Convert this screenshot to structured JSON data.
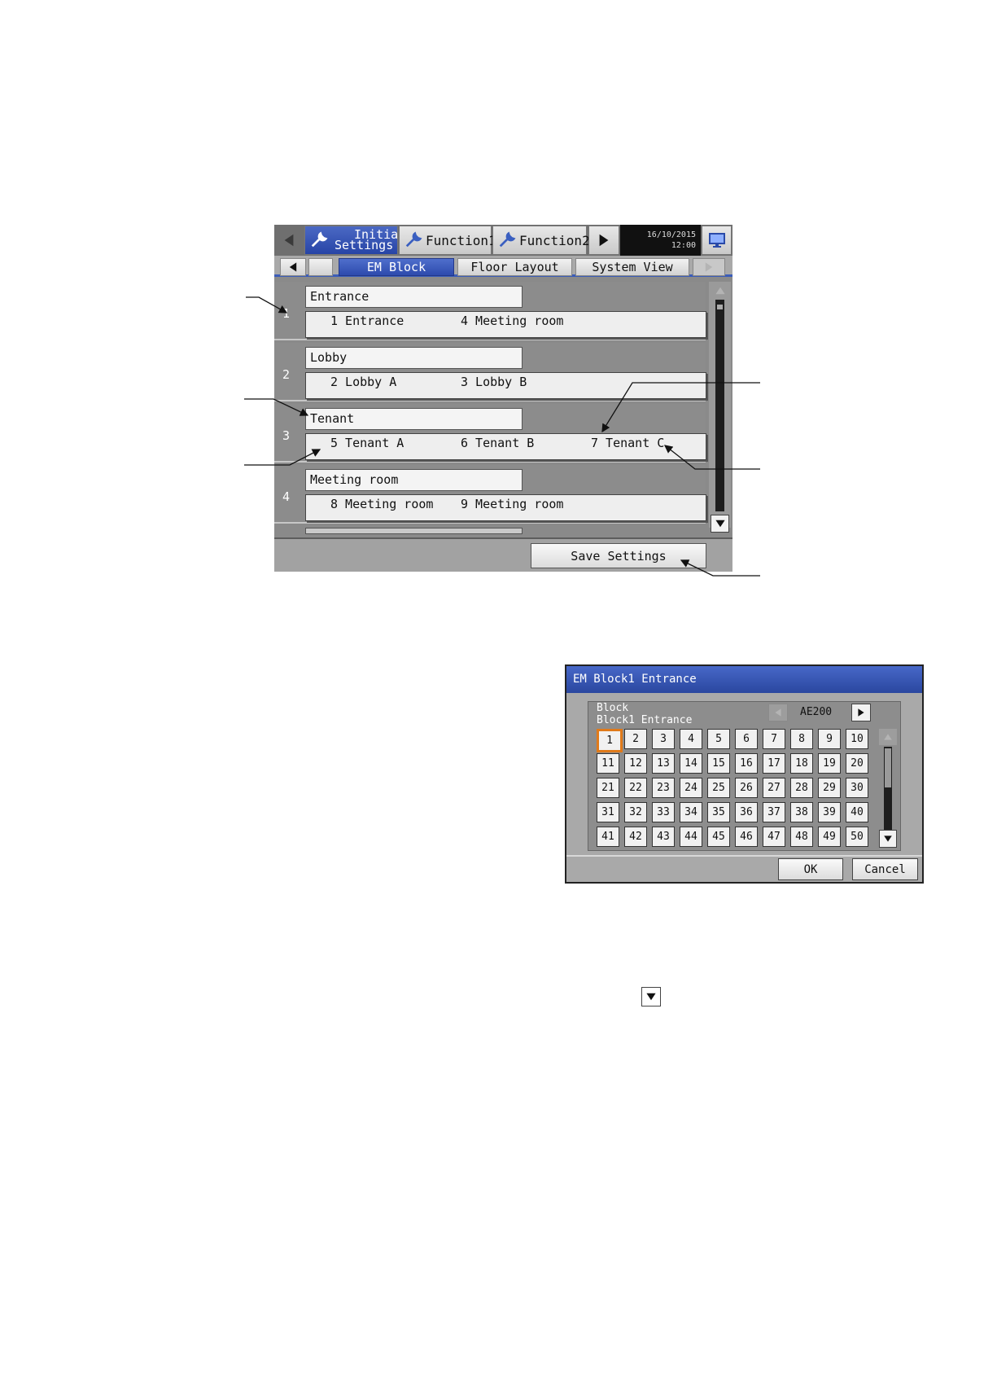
{
  "screen": {
    "tabs": {
      "initial": {
        "line1": "Initial",
        "line2": "Settings"
      },
      "function1": "Function1",
      "function2": "Function2"
    },
    "datetime": {
      "date": "16/10/2015",
      "time": "12:00"
    },
    "subtabs": {
      "em_block": "EM Block",
      "floor_layout": "Floor Layout",
      "system_view": "System View"
    },
    "rows": [
      {
        "num": "1",
        "name": "Entrance",
        "units": [
          "1 Entrance",
          "4 Meeting room"
        ]
      },
      {
        "num": "2",
        "name": "Lobby",
        "units": [
          "2 Lobby A",
          "3 Lobby B"
        ]
      },
      {
        "num": "3",
        "name": "Tenant",
        "units": [
          "5 Tenant A",
          "6 Tenant B",
          "7 Tenant C"
        ]
      },
      {
        "num": "4",
        "name": "Meeting room",
        "units": [
          "8 Meeting room",
          "9 Meeting room"
        ]
      }
    ],
    "save_label": "Save Settings"
  },
  "dialog": {
    "title": "EM Block1 Entrance",
    "block_label": "Block",
    "block_name": "Block1 Entrance",
    "controller": "AE200",
    "cells": [
      "1",
      "2",
      "3",
      "4",
      "5",
      "6",
      "7",
      "8",
      "9",
      "10",
      "11",
      "12",
      "13",
      "14",
      "15",
      "16",
      "17",
      "18",
      "19",
      "20",
      "21",
      "22",
      "23",
      "24",
      "25",
      "26",
      "27",
      "28",
      "29",
      "30",
      "31",
      "32",
      "33",
      "34",
      "35",
      "36",
      "37",
      "38",
      "39",
      "40",
      "41",
      "42",
      "43",
      "44",
      "45",
      "46",
      "47",
      "48",
      "49",
      "50"
    ],
    "selected": "1",
    "ok_label": "OK",
    "cancel_label": "Cancel"
  },
  "colors": {
    "accent": "#2d4aad",
    "selected_border": "#e07a1a"
  }
}
